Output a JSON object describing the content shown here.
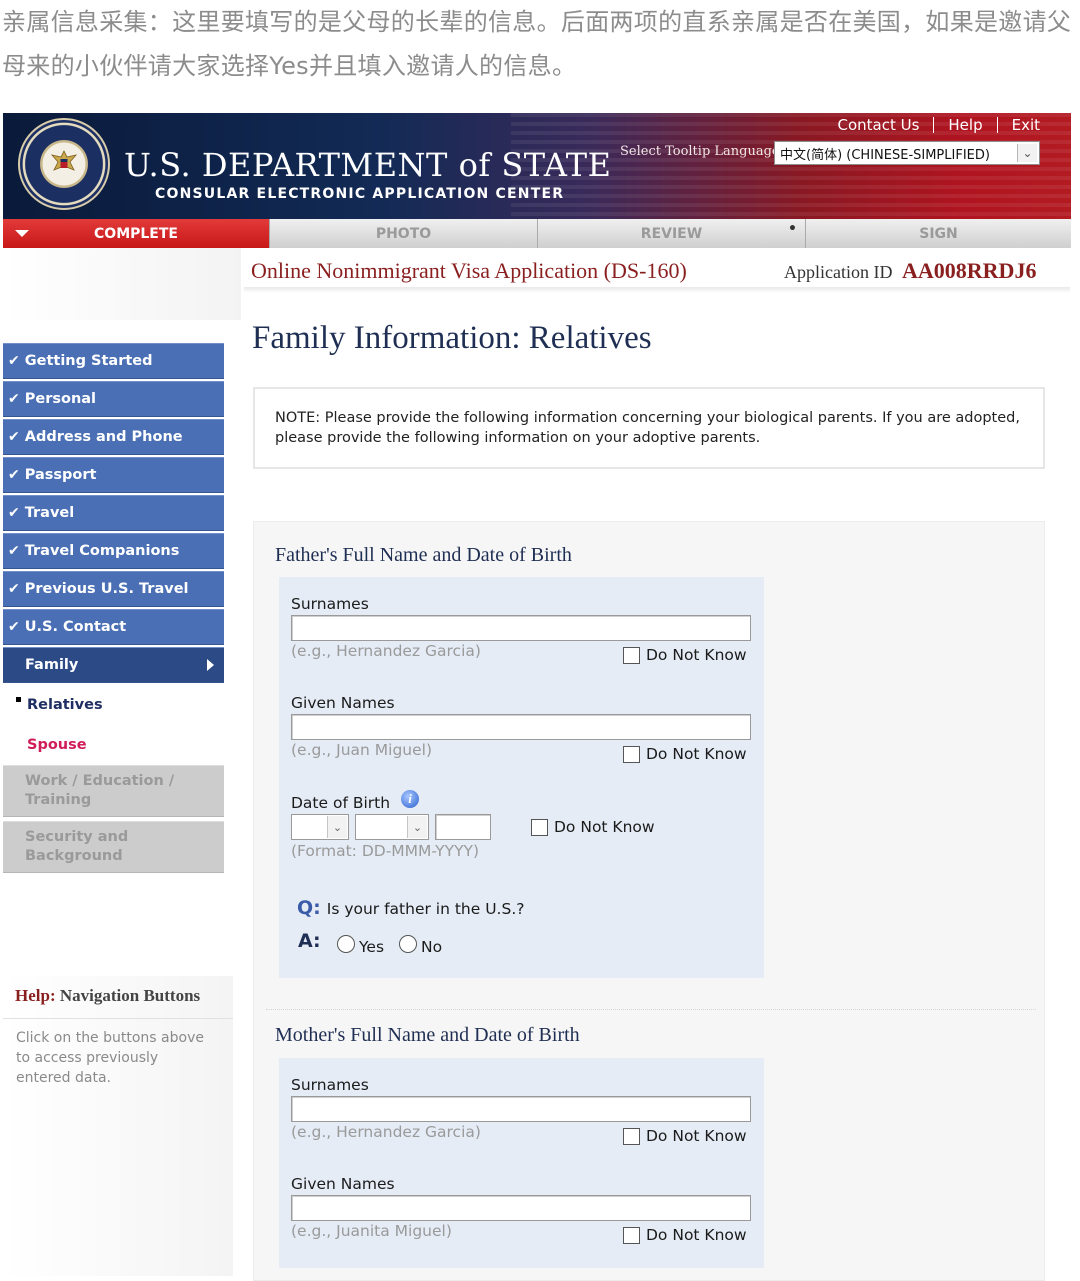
{
  "caption": "亲属信息采集：这里要填写的是父母的长辈的信息。后面两项的直系亲属是否在美国，如果是邀请父母来的小伙伴请大家选择Yes并且填入邀请人的信息。",
  "header": {
    "top_links": [
      "Contact Us",
      "Help",
      "Exit"
    ],
    "dept_title": "U.S. DEPARTMENT of STATE",
    "dept_subtitle": "CONSULAR ELECTRONIC APPLICATION CENTER",
    "tooltip_label": "Select Tooltip Language",
    "language_value": "中文(简体)  (CHINESE-SIMPLIFIED)",
    "colors": {
      "banner_blue": "#122a55",
      "banner_red": "#b31b22"
    }
  },
  "progress_tabs": [
    {
      "label": "COMPLETE",
      "active": true
    },
    {
      "label": "PHOTO",
      "active": false
    },
    {
      "label": "REVIEW",
      "active": false
    },
    {
      "label": "SIGN",
      "active": false
    }
  ],
  "form_title": "Online Nonimmigrant Visa Application (DS-160)",
  "application_id_label": "Application ID",
  "application_id": "AA008RRDJ6",
  "sidebar": {
    "items": [
      {
        "label": "Getting Started",
        "state": "done"
      },
      {
        "label": "Personal",
        "state": "done"
      },
      {
        "label": "Address and Phone",
        "state": "done"
      },
      {
        "label": "Passport",
        "state": "done"
      },
      {
        "label": "Travel",
        "state": "done"
      },
      {
        "label": "Travel Companions",
        "state": "done"
      },
      {
        "label": "Previous U.S. Travel",
        "state": "done"
      },
      {
        "label": "U.S. Contact",
        "state": "done"
      },
      {
        "label": "Family",
        "state": "current"
      }
    ],
    "sub_items": [
      {
        "label": "Relatives",
        "state": "selected"
      },
      {
        "label": "Spouse",
        "state": "link"
      }
    ],
    "disabled_items": [
      {
        "label": "Work / Education / Training"
      },
      {
        "label": "Security and Background"
      }
    ],
    "check_glyph": "✔"
  },
  "help": {
    "title_prefix": "Help:",
    "title_rest": "Navigation Buttons",
    "text": "Click on the buttons above to access previously entered data."
  },
  "main": {
    "page_title": "Family Information: Relatives",
    "note": "NOTE: Please provide the following information concerning your biological parents. If you are adopted, please provide the following information on your adoptive parents.",
    "father": {
      "section_title": "Father's Full Name and Date of Birth",
      "surnames_label": "Surnames",
      "surnames_value": "",
      "surnames_hint": "(e.g., Hernandez Garcia)",
      "given_label": "Given Names",
      "given_value": "",
      "given_hint": "(e.g., Juan Miguel)",
      "dob_label": "Date of Birth",
      "dob_hint": "(Format: DD-MMM-YYYY)",
      "do_not_know": "Do Not Know",
      "question": "Is your father in the U.S.?",
      "q_prefix": "Q:",
      "a_prefix": "A:",
      "yes": "Yes",
      "no": "No"
    },
    "mother": {
      "section_title": "Mother's Full Name and Date of Birth",
      "surnames_label": "Surnames",
      "surnames_value": "",
      "surnames_hint": "(e.g., Hernandez Garcia)",
      "given_label": "Given Names",
      "given_value": "",
      "given_hint": "(e.g., Juanita Miguel)",
      "do_not_know": "Do Not Know"
    }
  }
}
